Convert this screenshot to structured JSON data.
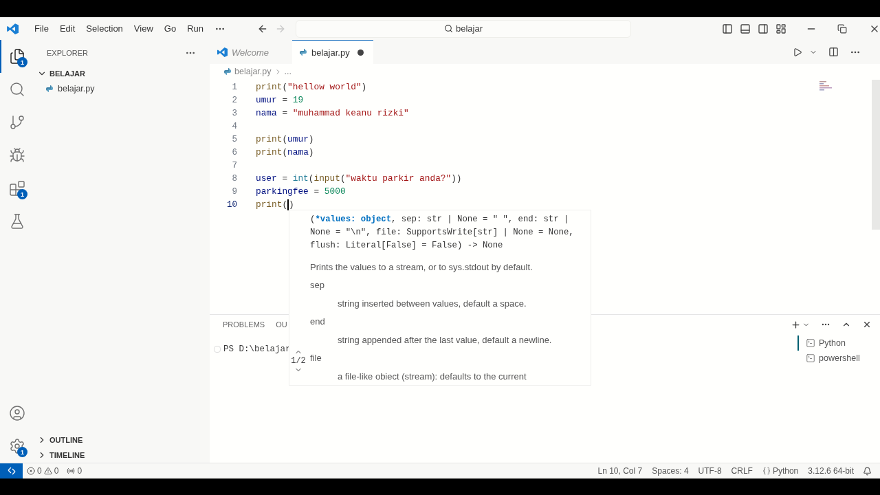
{
  "menu": [
    "File",
    "Edit",
    "Selection",
    "View",
    "Go",
    "Run"
  ],
  "search": {
    "value": "belajar"
  },
  "activity_bar": [
    {
      "kind": "explorer",
      "selected": true,
      "badge": "1"
    },
    {
      "kind": "search",
      "selected": false
    },
    {
      "kind": "source-control",
      "selected": false
    },
    {
      "kind": "run",
      "selected": false
    },
    {
      "kind": "extensions",
      "selected": false,
      "badge": "1"
    },
    {
      "kind": "testing",
      "selected": false
    }
  ],
  "activity_bottom": [
    {
      "kind": "account"
    },
    {
      "kind": "settings",
      "badge": "1"
    }
  ],
  "sidebar": {
    "title": "EXPLORER",
    "folder": {
      "name": "BELAJAR",
      "expanded": true,
      "children": [
        {
          "name": "belajar.py"
        }
      ]
    },
    "sections": [
      {
        "name": "OUTLINE",
        "expanded": false
      },
      {
        "name": "TIMELINE",
        "expanded": false
      }
    ]
  },
  "tabs": [
    {
      "label": "Welcome",
      "kind": "welcome",
      "selected": false,
      "preview": true,
      "modified": false
    },
    {
      "label": "belajar.py",
      "kind": "python",
      "selected": true,
      "preview": false,
      "modified": true
    }
  ],
  "breadcrumb": [
    "belajar.py",
    "..."
  ],
  "code": [
    {
      "number": "1",
      "active": false,
      "tokens": [
        {
          "kind": "fn",
          "text": "print"
        },
        {
          "kind": "punc",
          "text": "("
        },
        {
          "kind": "str",
          "text": "\"hellow world\""
        },
        {
          "kind": "punc",
          "text": ")"
        }
      ]
    },
    {
      "number": "2",
      "active": false,
      "tokens": [
        {
          "kind": "var",
          "text": "umur"
        },
        {
          "kind": "punc",
          "text": " = "
        },
        {
          "kind": "num",
          "text": "19"
        }
      ]
    },
    {
      "number": "3",
      "active": false,
      "tokens": [
        {
          "kind": "var",
          "text": "nama"
        },
        {
          "kind": "punc",
          "text": " = "
        },
        {
          "kind": "str",
          "text": "\"muhammad keanu rizki\""
        }
      ]
    },
    {
      "number": "4",
      "active": false
    },
    {
      "number": "5",
      "active": false,
      "tokens": [
        {
          "kind": "fn",
          "text": "print"
        },
        {
          "kind": "punc",
          "text": "("
        },
        {
          "kind": "var",
          "text": "umur"
        },
        {
          "kind": "punc",
          "text": ")"
        }
      ]
    },
    {
      "number": "6",
      "active": false,
      "tokens": [
        {
          "kind": "fn",
          "text": "print"
        },
        {
          "kind": "punc",
          "text": "("
        },
        {
          "kind": "var",
          "text": "nama"
        },
        {
          "kind": "punc",
          "text": ")"
        }
      ]
    },
    {
      "number": "7",
      "active": false
    },
    {
      "number": "8",
      "active": false,
      "tokens": [
        {
          "kind": "var",
          "text": "user"
        },
        {
          "kind": "punc",
          "text": " = "
        },
        {
          "kind": "type",
          "text": "int"
        },
        {
          "kind": "punc",
          "text": "("
        },
        {
          "kind": "fn",
          "text": "input"
        },
        {
          "kind": "punc",
          "text": "("
        },
        {
          "kind": "str",
          "text": "\"waktu parkir anda?\""
        },
        {
          "kind": "punc",
          "text": "))"
        }
      ]
    },
    {
      "number": "9",
      "active": false,
      "tokens": [
        {
          "kind": "var",
          "text": "parkingfee"
        },
        {
          "kind": "punc",
          "text": " = "
        },
        {
          "kind": "num",
          "text": "5000"
        }
      ]
    },
    {
      "number": "10",
      "active": true,
      "tokens": [
        {
          "kind": "fn",
          "text": "print"
        },
        {
          "kind": "punc",
          "text": "("
        },
        {
          "kind": "punc",
          "text": ")",
          "caret_before": true
        }
      ]
    }
  ],
  "signature": {
    "lines": [
      [
        {
          "kind": "punc",
          "text": "("
        },
        {
          "kind": "active",
          "text": "*values: object"
        },
        {
          "kind": "punc",
          "text": ", sep: str | None = \" \", end: str |"
        }
      ],
      [
        {
          "kind": "punc",
          "text": "None = \"\\n\", file: SupportsWrite[str] | None = None,"
        }
      ],
      [
        {
          "kind": "punc",
          "text": "flush: Literal[False] = False) -> None"
        }
      ]
    ],
    "description": "Prints the values to a stream, or to sys.stdout by default.",
    "params": [
      {
        "name": "sep",
        "doc": "string inserted between values, default a space."
      },
      {
        "name": "end",
        "doc": "string appended after the last value, default a newline."
      },
      {
        "name": "file",
        "doc": "a file-like obiect (stream): defaults to the current"
      }
    ],
    "pager": "1/2"
  },
  "panel": {
    "tabs": [
      "PROBLEMS",
      "OU"
    ],
    "terminal_line": "PS D:\\belajar",
    "terminals": [
      {
        "label": "Python",
        "selected": true
      },
      {
        "label": "powershell",
        "selected": false
      }
    ]
  },
  "status": {
    "errors": "0",
    "warnings": "0",
    "ports": "0",
    "right": [
      {
        "kind": "text",
        "text": "Ln 10, Col 7"
      },
      {
        "kind": "text",
        "text": "Spaces: 4"
      },
      {
        "kind": "text",
        "text": "UTF-8"
      },
      {
        "kind": "text",
        "text": "CRLF"
      },
      {
        "kind": "language",
        "text": "Python"
      },
      {
        "kind": "text",
        "text": "3.12.6 64-bit"
      }
    ]
  }
}
